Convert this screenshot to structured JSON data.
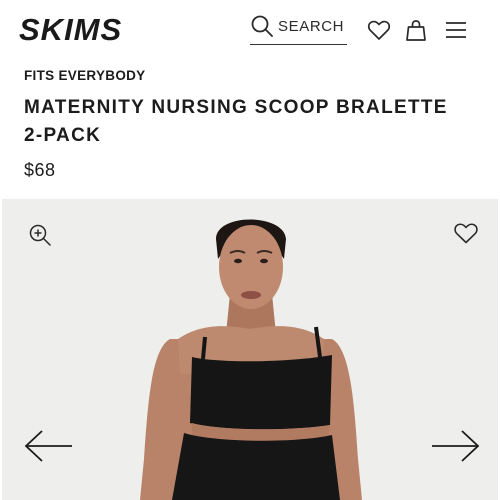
{
  "header": {
    "brand": "SKIMS",
    "search_label": "SEARCH"
  },
  "product": {
    "eyebrow": "FITS EVERYBODY",
    "title": "MATERNITY NURSING SCOOP BRALETTE 2-PACK",
    "price": "$68"
  },
  "icons": {
    "search": "search-icon",
    "wishlist": "heart-icon",
    "bag": "shopping-bag-icon",
    "menu": "hamburger-menu-icon",
    "zoom": "zoom-in-icon",
    "prev": "arrow-left-icon",
    "next": "arrow-right-icon"
  },
  "colors": {
    "text": "#1c1c1c",
    "gallery_bg": "#eeeeec",
    "garment": "#151515",
    "skin": "#b9836a"
  }
}
